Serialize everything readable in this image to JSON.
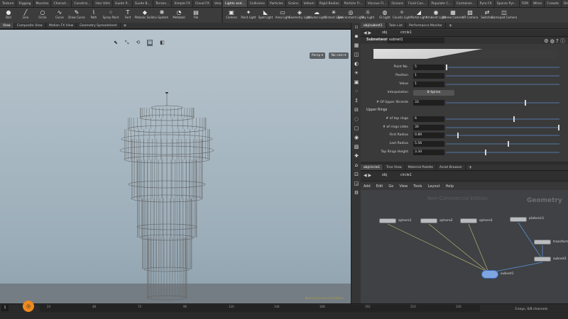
{
  "shelf_tabs_left": [
    "Texture",
    "Rigging",
    "Muscles",
    "Charact...",
    "Constrai...",
    "Hair Utils",
    "Guide P...",
    "Guide B...",
    "Terrain...",
    "Simple FX",
    "Cloud FX",
    "Volume"
  ],
  "shelf_tabs_right": [
    "Lights and...",
    "Collisions",
    "Particles",
    "Grains",
    "Vellum",
    "Rigid Bodies",
    "Particle Fl...",
    "Viscous Fl...",
    "Oceans",
    "Fluid Con...",
    "Populate C...",
    "Container...",
    "Pyro FX",
    "Sparse Pyr...",
    "FEM",
    "Wires",
    "Crowds",
    "Drive Sim..."
  ],
  "shelf_tools_left": [
    {
      "icon": "●",
      "label": "Ball"
    },
    {
      "icon": "╱",
      "label": "Line"
    },
    {
      "icon": "○",
      "label": "Circle"
    },
    {
      "icon": "∿",
      "label": "Curve"
    },
    {
      "icon": "✎",
      "label": "Draw Curve"
    },
    {
      "icon": "⌇",
      "label": "Path"
    },
    {
      "icon": "⁘",
      "label": "Spray Paint"
    },
    {
      "icon": "T",
      "label": "Font"
    },
    {
      "icon": "◆",
      "label": "Platonic Solids"
    },
    {
      "icon": "❋",
      "label": "L-System"
    },
    {
      "icon": "◔",
      "label": "Metaball"
    },
    {
      "icon": "▤",
      "label": "File"
    }
  ],
  "shelf_tools_right": [
    {
      "icon": "▣",
      "label": "Camera"
    },
    {
      "icon": "✦",
      "label": "Point Light"
    },
    {
      "icon": "◣",
      "label": "Spot Light"
    },
    {
      "icon": "▭",
      "label": "Area Light"
    },
    {
      "icon": "◈",
      "label": "Geometry Light"
    },
    {
      "icon": "☁",
      "label": "Volume Light"
    },
    {
      "icon": "☀",
      "label": "Distant Light"
    },
    {
      "icon": "◎",
      "label": "Environment Light"
    },
    {
      "icon": "☼",
      "label": "Sky Light"
    },
    {
      "icon": "◍",
      "label": "GI Light"
    },
    {
      "icon": "✧",
      "label": "Caustic Light"
    },
    {
      "icon": "◢",
      "label": "Portal Light"
    },
    {
      "icon": "◉",
      "label": "Ambient Light"
    },
    {
      "icon": "▦",
      "label": "Stereo Camera"
    },
    {
      "icon": "▧",
      "label": "VR Camera"
    },
    {
      "icon": "⇄",
      "label": "Switcher"
    },
    {
      "icon": "◫",
      "label": "Gamepad Camera"
    }
  ],
  "viewport_tabs": [
    "View",
    "Composite View",
    "Motion FX View",
    "Geometry Spreadsheet"
  ],
  "viewport": {
    "persp": "Persp ▾",
    "cam": "No cam ▾",
    "watermark": "Non-Commercial Edition"
  },
  "param_tabs": [
    "obj/subnet1",
    "Take List",
    "Performance Monitor"
  ],
  "param_path": {
    "context": "obj",
    "node": "circle1"
  },
  "node_header": {
    "type": "Subnetwork",
    "name": "subnet1"
  },
  "params": [
    {
      "label": "Point No.",
      "value": "5",
      "knob": 0
    },
    {
      "label": "Position",
      "value": "1",
      "knob": null
    },
    {
      "label": "Value",
      "value": "1",
      "knob": null
    },
    {
      "label": "Interpolation",
      "value": "B-Spline",
      "type": "select"
    },
    {
      "label": "# Of Upper Strands",
      "value": "33",
      "knob": 0.7
    }
  ],
  "section_upper": "Upper Rings",
  "upper_params": [
    {
      "label": "# of top rings",
      "value": "6",
      "knob": 0.6
    },
    {
      "label": "# of rings sides",
      "value": "30",
      "knob": 1.0
    },
    {
      "label": "First Radius",
      "value": "0.89",
      "knob": 0.1
    },
    {
      "label": "Last Radius",
      "value": "5.56",
      "knob": 0.55
    },
    {
      "label": "Top Rings Height",
      "value": "3.34",
      "knob": 0.35
    }
  ],
  "net_tabs": [
    "obj/circle1",
    "Tree View",
    "Material Palette",
    "Asset Browser"
  ],
  "net_path": {
    "context": "obj",
    "node": "circle1"
  },
  "net_menu": [
    "Add",
    "Edit",
    "Go",
    "View",
    "Tools",
    "Layout",
    "Help"
  ],
  "network": {
    "noncommercial": "Non-Commercial Edition",
    "context_label": "Geometry",
    "nodes": [
      "sphere1",
      "sphere2",
      "sphere3",
      "platonic1",
      "transform1",
      "subnet2",
      "subnet1"
    ]
  },
  "timeline": {
    "frame": "1",
    "ticks": [
      "24",
      "48",
      "72",
      "96",
      "120",
      "144",
      "168",
      "192",
      "216",
      "240"
    ],
    "status": "3 keys, 0/8 channels"
  }
}
